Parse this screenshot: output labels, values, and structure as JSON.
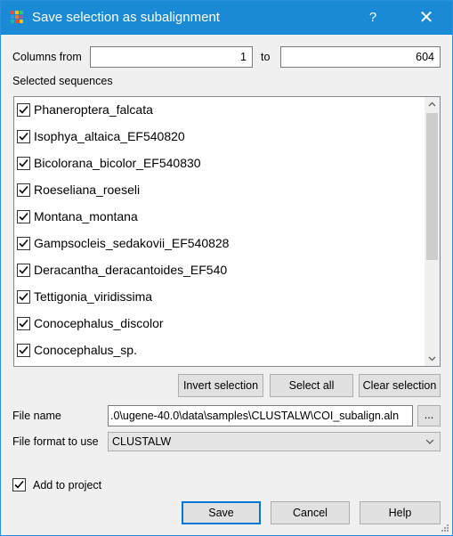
{
  "window": {
    "title": "Save selection as subalignment",
    "help_glyph": "?",
    "close_glyph": "✕"
  },
  "columns": {
    "from_label": "Columns from",
    "from_value": "1",
    "to_label": "to",
    "to_value": "604"
  },
  "sequences": {
    "label": "Selected sequences",
    "items": [
      {
        "name": "Phaneroptera_falcata",
        "checked": true
      },
      {
        "name": "Isophya_altaica_EF540820",
        "checked": true
      },
      {
        "name": "Bicolorana_bicolor_EF540830",
        "checked": true
      },
      {
        "name": "Roeseliana_roeseli",
        "checked": true
      },
      {
        "name": "Montana_montana",
        "checked": true
      },
      {
        "name": "Gampsocleis_sedakovii_EF540828",
        "checked": true
      },
      {
        "name": "Deracantha_deracantoides_EF540",
        "checked": true
      },
      {
        "name": "Tettigonia_viridissima",
        "checked": true
      },
      {
        "name": "Conocephalus_discolor",
        "checked": true
      },
      {
        "name": "Conocephalus_sp.",
        "checked": true
      }
    ]
  },
  "selection_buttons": {
    "invert": "Invert selection",
    "select_all": "Select all",
    "clear": "Clear selection"
  },
  "file": {
    "name_label": "File name",
    "name_value": ".0\\ugene-40.0\\data\\samples\\CLUSTALW\\COI_subalign.aln",
    "browse_label": "...",
    "format_label": "File format to use",
    "format_value": "CLUSTALW"
  },
  "add_to_project": {
    "label": "Add to project",
    "checked": true
  },
  "footer": {
    "save": "Save",
    "cancel": "Cancel",
    "help": "Help"
  },
  "colors": {
    "titlebar": "#1a8ad6",
    "default_button_border": "#0078d7"
  }
}
